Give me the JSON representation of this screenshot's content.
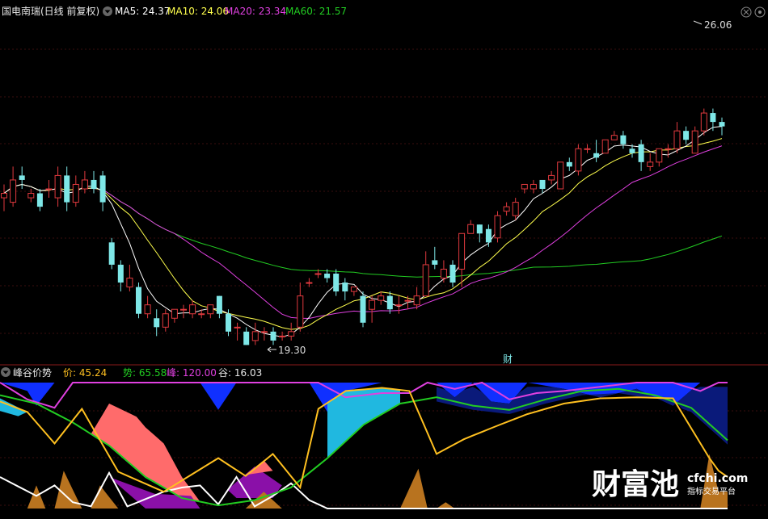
{
  "header": {
    "stock_title": "国电南瑞(日线 前复权)",
    "ma5_label": "MA5: 24.37",
    "ma10_label": "MA10: 24.06",
    "ma20_label": "MA20: 23.34",
    "ma60_label": "MA60: 21.57"
  },
  "indicator_header": {
    "name": "峰谷价势",
    "price_label": "价: 45.24",
    "trend_label": "势: 65.58",
    "peak_label": "峰: 120.00",
    "valley_label": "谷: 16.03"
  },
  "annotations": {
    "high_label": "26.06",
    "low_label": "19.30",
    "cai_marker": "财"
  },
  "watermark": {
    "brand": "财富池",
    "domain": "cfchi.com",
    "slogan": "指标交易平台"
  },
  "colors": {
    "up": "#e0393e",
    "down": "#7ee7e7",
    "ma5": "#ffffff",
    "ma10": "#ffff4d",
    "ma20": "#e040e0",
    "ma60": "#22cc22",
    "price_line": "#ffc020",
    "trend_line": "#22cc22",
    "peak_line": "#e040e0",
    "valley_fill": "#b8731f"
  },
  "chart_data": [
    {
      "type": "candlestick",
      "title": "国电南瑞(日线 前复权)",
      "ylim": [
        19.0,
        26.6
      ],
      "annotations": [
        {
          "label": "26.06",
          "type": "high"
        },
        {
          "label": "19.30",
          "type": "low"
        }
      ],
      "candles": [
        [
          22.6,
          22.7,
          22.3,
          22.9
        ],
        [
          22.5,
          23.0,
          22.4,
          23.3
        ],
        [
          23.1,
          23.0,
          22.8,
          23.3
        ],
        [
          22.6,
          22.7,
          22.5,
          22.8
        ],
        [
          22.7,
          22.4,
          22.3,
          22.8
        ],
        [
          22.8,
          22.8,
          22.6,
          23.0
        ],
        [
          22.6,
          23.1,
          22.4,
          23.3
        ],
        [
          23.1,
          22.5,
          22.3,
          23.3
        ],
        [
          22.5,
          22.9,
          22.4,
          23.1
        ],
        [
          22.8,
          23.0,
          22.7,
          23.2
        ],
        [
          23.0,
          22.8,
          22.7,
          23.2
        ],
        [
          23.1,
          22.5,
          22.3,
          23.2
        ],
        [
          21.6,
          21.1,
          21.0,
          21.7
        ],
        [
          21.1,
          20.7,
          20.5,
          21.2
        ],
        [
          20.6,
          20.8,
          20.5,
          21.1
        ],
        [
          20.6,
          20.0,
          19.9,
          20.7
        ],
        [
          20.0,
          20.2,
          19.9,
          20.4
        ],
        [
          19.9,
          19.7,
          19.5,
          20.1
        ],
        [
          19.7,
          20.0,
          19.6,
          20.1
        ],
        [
          19.9,
          20.1,
          19.8,
          20.1
        ],
        [
          20.1,
          20.1,
          19.9,
          20.2
        ],
        [
          20.0,
          20.2,
          19.9,
          20.3
        ],
        [
          20.0,
          20.0,
          19.9,
          20.1
        ],
        [
          20.0,
          20.2,
          19.9,
          20.2
        ],
        [
          20.4,
          20.0,
          19.9,
          20.4
        ],
        [
          20.0,
          19.6,
          19.5,
          20.1
        ],
        [
          19.7,
          19.7,
          19.4,
          19.8
        ],
        [
          19.6,
          19.3,
          19.3,
          19.7
        ],
        [
          19.4,
          19.6,
          19.3,
          19.8
        ],
        [
          19.6,
          19.6,
          19.4,
          19.7
        ],
        [
          19.6,
          19.4,
          19.3,
          19.7
        ],
        [
          19.5,
          19.5,
          19.4,
          19.6
        ],
        [
          19.5,
          19.6,
          19.4,
          19.8
        ],
        [
          19.7,
          20.4,
          19.6,
          20.7
        ],
        [
          20.7,
          20.7,
          20.6,
          20.8
        ],
        [
          20.9,
          20.9,
          20.8,
          21.0
        ],
        [
          20.9,
          20.8,
          20.7,
          21.0
        ],
        [
          20.9,
          20.5,
          20.4,
          21.0
        ],
        [
          20.7,
          20.5,
          20.3,
          20.8
        ],
        [
          20.5,
          20.6,
          20.4,
          20.6
        ],
        [
          20.4,
          19.8,
          19.7,
          20.5
        ],
        [
          20.1,
          20.3,
          19.8,
          20.4
        ],
        [
          20.3,
          20.4,
          20.2,
          20.5
        ],
        [
          20.4,
          20.1,
          20.0,
          20.5
        ],
        [
          20.2,
          20.2,
          20.0,
          20.4
        ],
        [
          20.3,
          20.3,
          20.1,
          20.4
        ],
        [
          20.2,
          20.4,
          20.1,
          20.6
        ],
        [
          20.4,
          21.1,
          20.4,
          21.4
        ],
        [
          21.2,
          21.1,
          21.0,
          21.5
        ],
        [
          20.8,
          21.0,
          20.7,
          21.2
        ],
        [
          21.1,
          20.7,
          20.6,
          21.2
        ],
        [
          21.0,
          21.8,
          20.6,
          21.8
        ],
        [
          21.8,
          22.0,
          21.8,
          22.1
        ],
        [
          22.0,
          21.8,
          21.6,
          22.0
        ],
        [
          21.9,
          21.6,
          21.5,
          22.0
        ],
        [
          21.7,
          22.2,
          21.6,
          22.3
        ],
        [
          22.3,
          22.4,
          22.2,
          22.5
        ],
        [
          22.2,
          22.5,
          22.1,
          22.6
        ],
        [
          22.8,
          22.9,
          22.7,
          22.9
        ],
        [
          22.8,
          22.9,
          22.7,
          23.0
        ],
        [
          23.0,
          22.8,
          22.7,
          23.0
        ],
        [
          23.0,
          23.1,
          22.9,
          23.2
        ],
        [
          22.8,
          23.4,
          22.8,
          23.4
        ],
        [
          23.4,
          23.3,
          23.2,
          23.5
        ],
        [
          23.2,
          23.7,
          23.1,
          23.8
        ],
        [
          23.7,
          23.7,
          23.6,
          23.8
        ],
        [
          23.6,
          23.5,
          23.4,
          23.9
        ],
        [
          23.6,
          23.9,
          23.6,
          23.9
        ],
        [
          23.9,
          24.0,
          23.9,
          24.1
        ],
        [
          24.0,
          23.8,
          23.7,
          24.1
        ],
        [
          23.7,
          23.6,
          23.5,
          23.8
        ],
        [
          23.8,
          23.4,
          23.2,
          23.9
        ],
        [
          23.3,
          23.4,
          23.2,
          23.6
        ],
        [
          23.4,
          23.7,
          23.3,
          23.7
        ],
        [
          23.7,
          23.7,
          23.5,
          23.8
        ],
        [
          23.7,
          24.1,
          23.6,
          24.3
        ],
        [
          24.1,
          23.9,
          23.8,
          24.2
        ],
        [
          23.6,
          24.1,
          23.6,
          24.2
        ],
        [
          24.1,
          24.5,
          24.0,
          24.6
        ],
        [
          24.5,
          24.3,
          24.1,
          24.6
        ],
        [
          24.3,
          24.2,
          24.0,
          24.4
        ]
      ],
      "series": [
        {
          "name": "MA5",
          "last": 24.37
        },
        {
          "name": "MA10",
          "last": 24.06
        },
        {
          "name": "MA20",
          "last": 23.34
        },
        {
          "name": "MA60",
          "last": 21.57
        }
      ]
    },
    {
      "type": "line",
      "title": "峰谷价势",
      "ylim": [
        0,
        120
      ],
      "series": [
        {
          "name": "价",
          "last": 45.24
        },
        {
          "name": "势",
          "last": 65.58
        },
        {
          "name": "峰",
          "last": 120.0
        },
        {
          "name": "谷",
          "last": 16.03
        }
      ]
    }
  ]
}
